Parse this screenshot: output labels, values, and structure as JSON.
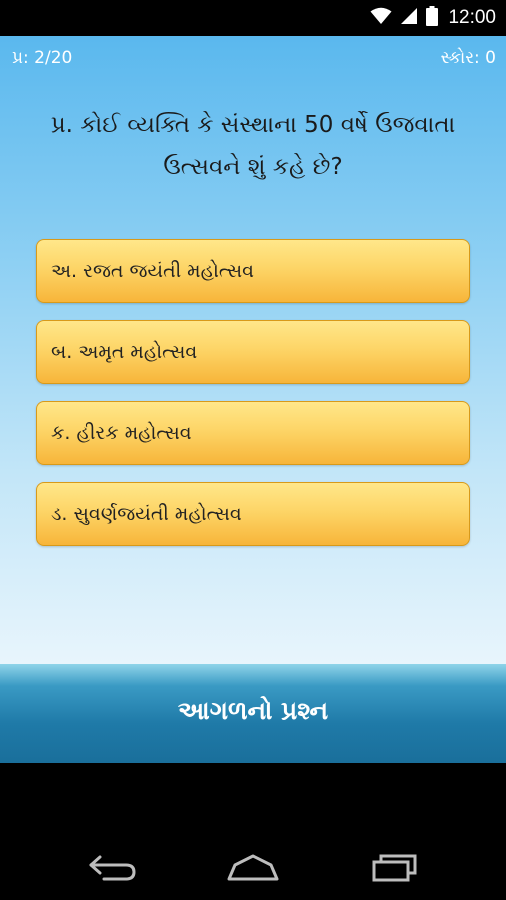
{
  "status_bar": {
    "time": "12:00",
    "icons": [
      "wifi-icon",
      "signal-icon",
      "battery-icon"
    ]
  },
  "header": {
    "question_counter": "પ્ર: 2/20",
    "score": "સ્કોર: 0"
  },
  "question": {
    "text": "પ્ર. કોઈ વ્યક્તિ કે સંસ્થાના 50 વર્ષે ઉજવાતા ઉત્સવને શું કહે છે?"
  },
  "options": [
    {
      "label": "અ. રજત જયંતી મહોત્સવ"
    },
    {
      "label": "બ. અમૃત મહોત્સવ"
    },
    {
      "label": "ક. હીરક મહોત્સવ"
    },
    {
      "label": "ડ. સુવર્ણજયંતી મહોત્સવ"
    }
  ],
  "next_button": {
    "label": "આગળનો પ્રશ્ન"
  },
  "nav_bar": {
    "icons": [
      "back-icon",
      "home-icon",
      "recents-icon"
    ]
  },
  "colors": {
    "app_gradient_top": "#5ab8ee",
    "option_fill": "#fdd567",
    "option_border": "#d89a1a",
    "next_bar": "#1f7aa8"
  }
}
